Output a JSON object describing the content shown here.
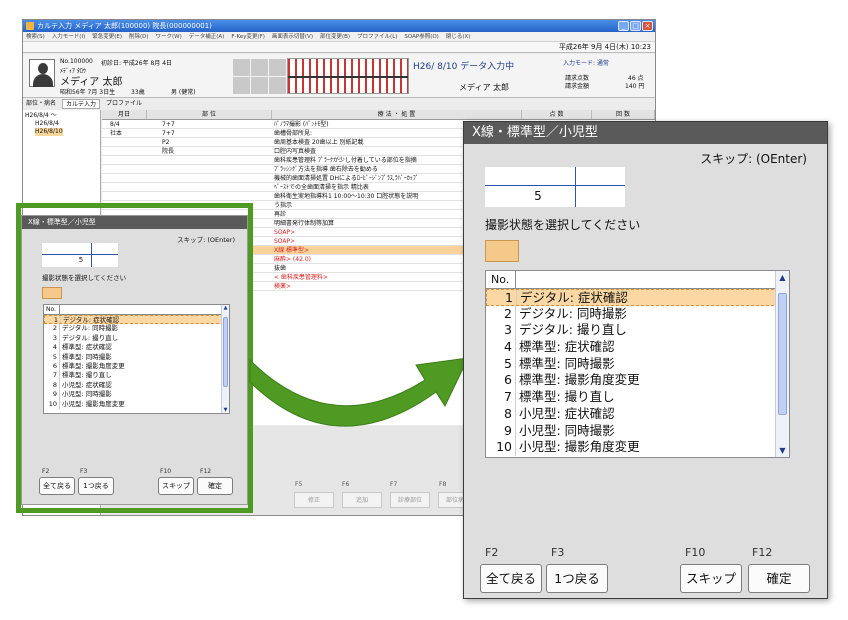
{
  "app": {
    "title": "カルテ入力 メディア 太郎(100000) 院長(000000001)",
    "menu": [
      "検索(S)",
      "入力モード(I)",
      "緊急変更(E)",
      "削除(D)",
      "ワーク(W)",
      "データ補正(A)",
      "F-Key変更(F)",
      "画面表示切替(V)",
      "部位変更(B)",
      "プロファイル(L)",
      "SOAP参照(O)",
      "閉じる(X)"
    ],
    "datetime": "平成26年 9月 4日(木) 10:23",
    "patient": {
      "id": "No.100000",
      "first_visit": "初診日: 平成26年 8月 4日",
      "kana": "ﾒﾃﾞｨｱ ﾀﾛｳ",
      "name": "メディア 太郎",
      "birth": "昭和56年 7月 3日生",
      "age": "33歳",
      "sex": "男 (健常)"
    },
    "status": "H26/ 8/10 データ入力中",
    "doctor": "メディア 太郎",
    "input_mode": "入力モード: 通常",
    "claim_points_label": "請求点数",
    "claim_points": "46 点",
    "claim_amount_label": "請求金額",
    "claim_amount": "140 円",
    "tabs": [
      "部位・病名",
      "カルテ入力",
      "プロファイル"
    ],
    "tree": [
      "H26/8/4 〜",
      "H26/8/4",
      "H26/8/10"
    ],
    "columns": [
      "月日",
      "部 位",
      "療 法 ・ 処 置",
      "点 数",
      "回 数"
    ],
    "records": [
      {
        "date": "8/4",
        "site": "7+7",
        "text": "ﾊﾟﾉﾗﾏ撮影 (ﾊﾟﾝﾄﾓ型)",
        "red": false,
        "hl": false
      },
      {
        "date": "社本",
        "site": "7+7",
        "text": "歯槽骨部所見:",
        "red": false,
        "hl": false
      },
      {
        "date": "",
        "site": "P2",
        "text": "歯周基本検査 20歯以上 別紙記載",
        "red": false,
        "hl": false
      },
      {
        "date": "",
        "site": "院長",
        "text": "口腔内写真検査",
        "red": false,
        "hl": false
      },
      {
        "date": "",
        "site": "",
        "text": "歯科疾患管理料 ﾌﾟﾗｰｸが少し付着している部位を指摘",
        "red": false,
        "hl": false
      },
      {
        "date": "",
        "site": "",
        "text": "ﾌﾞﾗｯｼﾝｸﾞ方法を指導 歯石除去を勧める",
        "red": false,
        "hl": false
      },
      {
        "date": "",
        "site": "",
        "text": "機械的歯面清掃処置 DHによるﾛｰﾋﾞｰｼﾞﾝﾌﾟﾗｽ,ﾗﾊﾞｰｶｯﾌﾟ",
        "red": false,
        "hl": false
      },
      {
        "date": "",
        "site": "",
        "text": "ﾍﾟｰｽﾄでの全歯面清掃を指示 精比表",
        "red": false,
        "hl": false
      },
      {
        "date": "",
        "site": "",
        "text": "歯科衛生実地指導料1 10:00〜10:30 口腔状態を説明",
        "red": false,
        "hl": false
      },
      {
        "date": "",
        "site": "",
        "text": "う指示",
        "red": false,
        "hl": false
      },
      {
        "date": "",
        "site": "",
        "text": "再診",
        "red": false,
        "hl": false
      },
      {
        "date": "",
        "site": "",
        "text": "明細書発行体制等加算",
        "red": false,
        "hl": false
      },
      {
        "date": "",
        "site": "",
        "text": "SOAP>",
        "red": true,
        "hl": false
      },
      {
        "date": "",
        "site": "",
        "text": "SOAP>",
        "red": true,
        "hl": false
      },
      {
        "date": "",
        "site": "",
        "text": "X線 標準型>",
        "red": true,
        "hl": true
      },
      {
        "date": "",
        "site": "",
        "text": "麻酔> (42.0)",
        "red": true,
        "hl": false
      },
      {
        "date": "",
        "site": "",
        "text": "抜歯",
        "red": false,
        "hl": false
      },
      {
        "date": "",
        "site": "",
        "text": "< 歯科疾患管理料>",
        "red": true,
        "hl": false
      },
      {
        "date": "",
        "site": "",
        "text": "検薬>",
        "red": true,
        "hl": false
      }
    ],
    "bg_fkeys": [
      "F5",
      "F6",
      "F7",
      "F8"
    ],
    "bg_buttons": [
      "修正",
      "追加",
      "診療部位",
      "部位病名"
    ]
  },
  "dialog": {
    "title": "X線・標準型／小児型",
    "skip_hint": "スキップ: (OEnter)",
    "value": "5",
    "prompt": "撮影状態を選択してください",
    "list_header_no": "No.",
    "items": [
      {
        "no": "1",
        "label": "デジタル: 症状確認"
      },
      {
        "no": "2",
        "label": "デジタル: 同時撮影"
      },
      {
        "no": "3",
        "label": "デジタル: 撮り直し"
      },
      {
        "no": "4",
        "label": "標準型: 症状確認"
      },
      {
        "no": "5",
        "label": "標準型: 同時撮影"
      },
      {
        "no": "6",
        "label": "標準型: 撮影角度変更"
      },
      {
        "no": "7",
        "label": "標準型: 撮り直し"
      },
      {
        "no": "8",
        "label": "小児型: 症状確認"
      },
      {
        "no": "9",
        "label": "小児型: 同時撮影"
      },
      {
        "no": "10",
        "label": "小児型: 撮影角度変更"
      }
    ],
    "selected_index": 0,
    "fkeys": [
      "F2",
      "F3",
      "F10",
      "F12"
    ],
    "buttons": {
      "back_all": "全て戻る",
      "back_one": "1つ戻る",
      "skip": "スキップ",
      "confirm": "確定"
    }
  },
  "colors": {
    "highlight_frame": "#4e9a22",
    "arrow": "#4e9a22",
    "selected_row": "#fbd8a3",
    "title_bar": "#5a5a5a"
  }
}
